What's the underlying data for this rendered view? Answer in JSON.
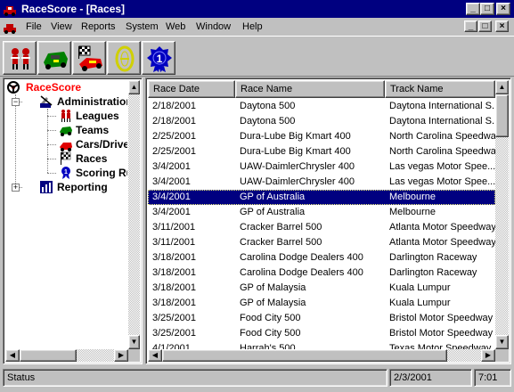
{
  "window": {
    "title": "RaceScore - [Races]",
    "minimize": "_",
    "maximize": "□",
    "close": "×"
  },
  "menu": [
    "File",
    "View",
    "Reports",
    "System",
    "Web",
    "Window",
    "Help"
  ],
  "toolbar": [
    {
      "icon": "drivers-icon"
    },
    {
      "icon": "car-green-icon"
    },
    {
      "icon": "car-checkered-flag-icon"
    },
    {
      "icon": "track-icon"
    },
    {
      "icon": "ribbon-first-place-icon"
    }
  ],
  "tree": {
    "root": "RaceScore",
    "administration": "Administration",
    "leagues": "Leagues",
    "teams": "Teams",
    "cars": "Cars/Drivers",
    "races": "Races",
    "scoring": "Scoring Rules",
    "reporting": "Reporting",
    "expand_minus": "−",
    "expand_plus": "+"
  },
  "grid": {
    "columns": [
      "Race Date",
      "Race Name",
      "Track Name"
    ],
    "rows": [
      [
        "2/18/2001",
        "Daytona 500",
        "Daytona International S..."
      ],
      [
        "2/18/2001",
        "Daytona 500",
        "Daytona International S..."
      ],
      [
        "2/25/2001",
        "Dura-Lube Big Kmart 400",
        "North Carolina Speedway"
      ],
      [
        "2/25/2001",
        "Dura-Lube Big Kmart 400",
        "North Carolina Speedway"
      ],
      [
        "3/4/2001",
        "UAW-DaimlerChrysler 400",
        "Las vegas Motor Spee..."
      ],
      [
        "3/4/2001",
        "UAW-DaimlerChrysler 400",
        "Las vegas Motor Spee..."
      ],
      [
        "3/4/2001",
        "GP of Australia",
        "Melbourne"
      ],
      [
        "3/4/2001",
        "GP of Australia",
        "Melbourne"
      ],
      [
        "3/11/2001",
        "Cracker Barrel 500",
        "Atlanta Motor Speedway"
      ],
      [
        "3/11/2001",
        "Cracker Barrel 500",
        "Atlanta Motor Speedway"
      ],
      [
        "3/18/2001",
        "Carolina Dodge Dealers 400",
        "Darlington Raceway"
      ],
      [
        "3/18/2001",
        "Carolina Dodge Dealers 400",
        "Darlington Raceway"
      ],
      [
        "3/18/2001",
        "GP of Malaysia",
        "Kuala Lumpur"
      ],
      [
        "3/18/2001",
        "GP of Malaysia",
        "Kuala Lumpur"
      ],
      [
        "3/25/2001",
        "Food City 500",
        "Bristol Motor Speedway"
      ],
      [
        "3/25/2001",
        "Food City 500",
        "Bristol Motor Speedway"
      ],
      [
        "4/1/2001",
        "Harrah's 500",
        "Texas Motor Speedway"
      ]
    ],
    "selected_row_index": 6
  },
  "status": {
    "text": "Status",
    "date": "2/3/2001",
    "time": "7:01"
  },
  "colors": {
    "titlebar": "#000080",
    "selection": "#000080",
    "root_label": "#ff0000"
  }
}
